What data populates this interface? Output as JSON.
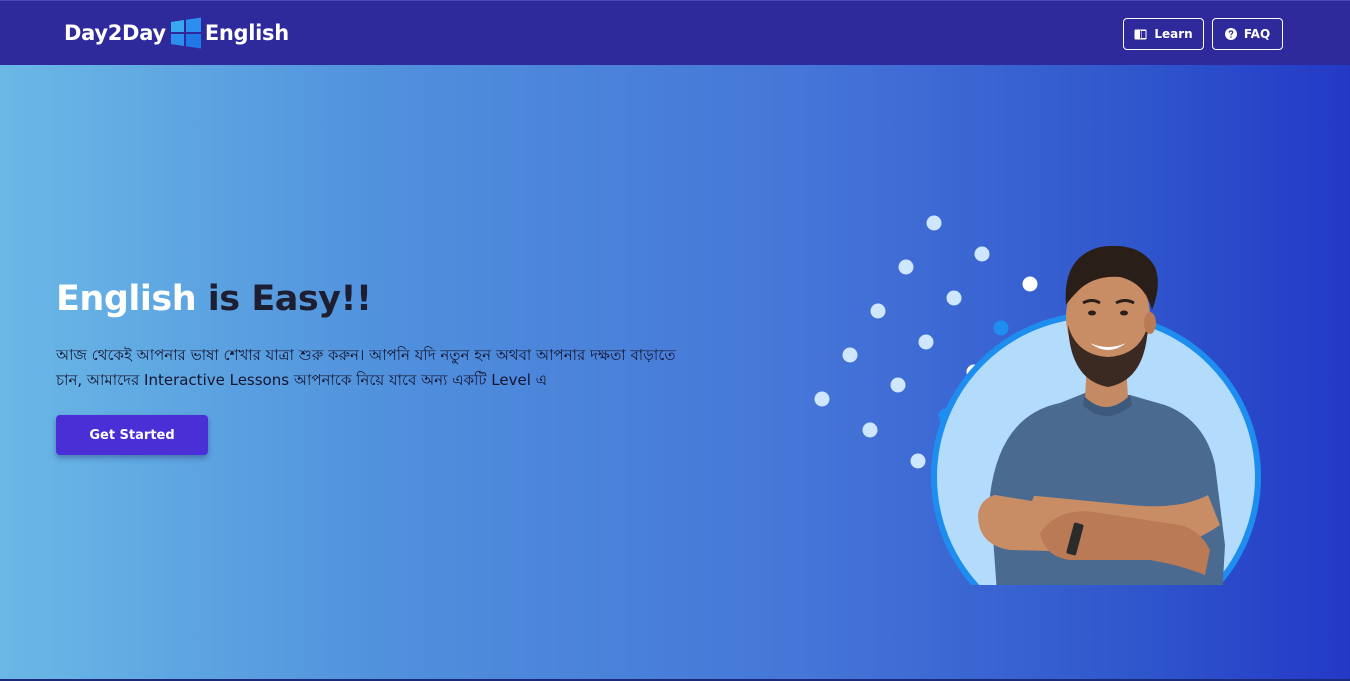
{
  "brand": {
    "name_left": "Day2Day",
    "name_right": "English",
    "logo_icon": "windows-tiles-icon"
  },
  "nav": {
    "learn": {
      "label": "Learn",
      "icon": "book-icon"
    },
    "faq": {
      "label": "FAQ",
      "icon": "question-circle-icon"
    }
  },
  "hero": {
    "title_highlight": "English",
    "title_rest": " is Easy!!",
    "description": "আজ থেকেই আপনার ভাষা শেখার যাত্রা শুরু করুন। আপনি যদি নতুন হন অথবা আপনার দক্ষতা বাড়াতে চান, আমাদের Interactive Lessons আপনাকে নিয়ে যাবে অন্য একটি Level এ",
    "cta_label": "Get Started",
    "image": "smiling-man-arms-crossed-photo"
  },
  "colors": {
    "navbar": "#2f2a9c",
    "gradient_start": "#6ab8e6",
    "gradient_end": "#2339c6",
    "cta": "#4a2fd6",
    "circle_ring": "#1e8df0",
    "circle_fill": "#b3dcfc"
  }
}
